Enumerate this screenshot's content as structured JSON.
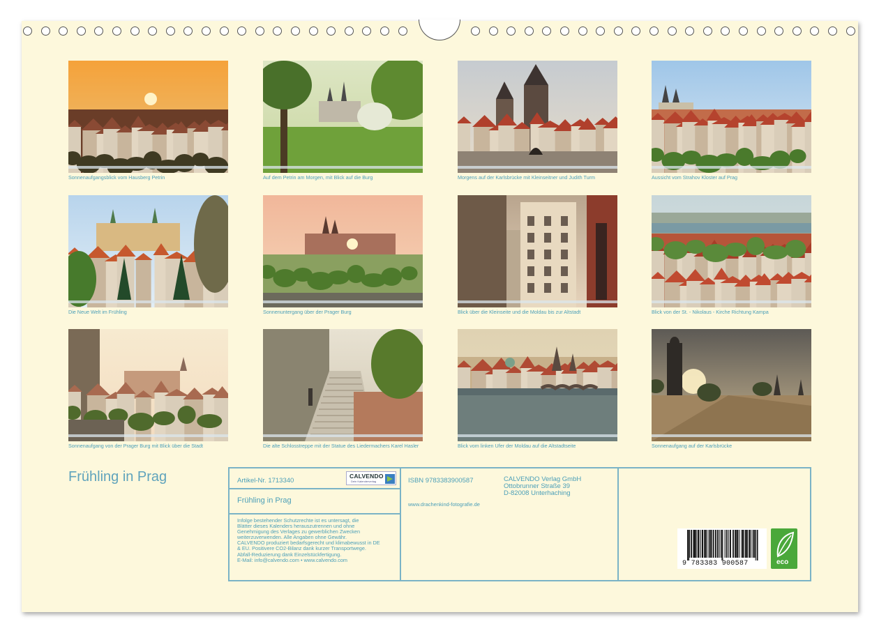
{
  "calendar": {
    "title": "Frühling in Prag"
  },
  "photos": [
    {
      "caption": "Sonnenaufgangsblick vom Hausberg Petrin",
      "scene": "sunrise"
    },
    {
      "caption": "Auf dem Petrin am Morgen, mit Blick auf die Burg",
      "scene": "garden"
    },
    {
      "caption": "Morgens auf der Karlsbrücke mit Kleinseitner und Judith Turm",
      "scene": "bridge-tower"
    },
    {
      "caption": "Aussicht vom Strahov Kloster auf Prag",
      "scene": "rooftops"
    },
    {
      "caption": "Die Neue Welt im Frühling",
      "scene": "spring"
    },
    {
      "caption": "Sonnenuntergang über der Prager Burg",
      "scene": "sunset-castle"
    },
    {
      "caption": "Blick über die Kleinseite und die Moldau bis zur Altstadt",
      "scene": "street"
    },
    {
      "caption": "Blick von der St. - Nikolaus - Kirche Richtung Kampa",
      "scene": "roofs-red"
    },
    {
      "caption": "Sonnenaufgang von der Prager Burg mit Blick über die Stadt",
      "scene": "hazy"
    },
    {
      "caption": "Die alte Schlosstreppe mit der Statue des Liedermachers Karel Hasler",
      "scene": "stairs"
    },
    {
      "caption": "Blick vom linken Ufer der Moldau auf die Altstadtseite",
      "scene": "river"
    },
    {
      "caption": "Sonnenaufgang auf der Karlsbrücke",
      "scene": "statue"
    }
  ],
  "info": {
    "article": "Artikel-Nr. 1713340",
    "logo_text": "CALVENDO",
    "logo_sub": "Dein Kalenderverlag",
    "title": "Frühling in Prag",
    "legal": [
      "Infolge bestehender Schutzrechte ist es untersagt, die",
      "Blätter dieses Kalenders herauszutrennen und ohne",
      "Genehmigung des Verlages zu gewerblichen Zwecken",
      "weiterzuverwenden. Alle Angaben ohne Gewähr.",
      "CALVENDO produziert bedarfsgerecht und klimabewusst in DE",
      "& EU. Positivere CO2-Bilanz dank kurzer Transportwege.",
      "Abfall-Reduzierung dank Einzelstückfertigung.",
      "E-Mail: info@calvendo.com • www.calvendo.com"
    ],
    "isbn": "ISBN 9783383900587",
    "publisher": [
      "CALVENDO Verlag GmbH",
      "Ottobrunner Straße 39",
      "D-82008 Unterhaching"
    ],
    "website": "www.drachenkind-fotografie.de",
    "barcode_digits": "9 783383 900587",
    "eco_label": "eco"
  }
}
